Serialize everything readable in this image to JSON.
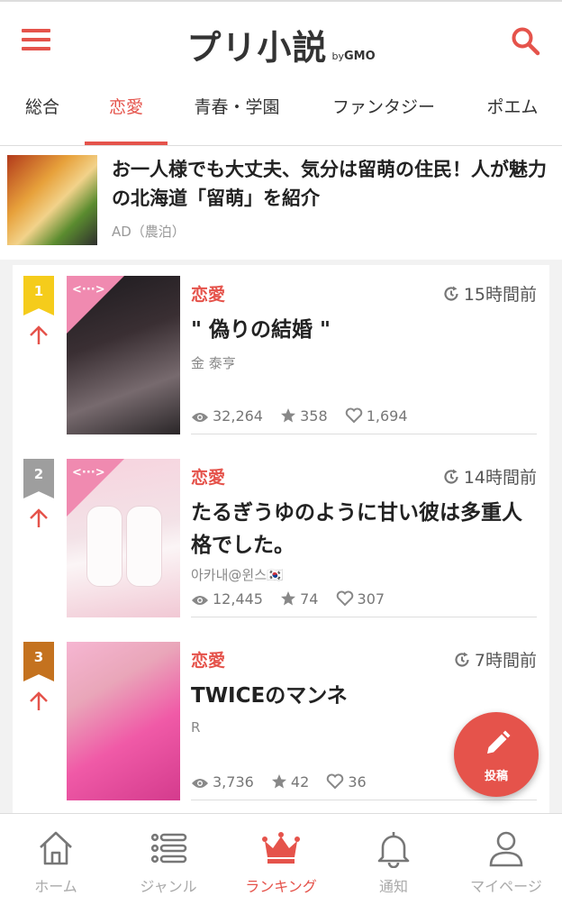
{
  "header": {
    "logo_main": "プリ小説",
    "logo_by": "by",
    "logo_gmo": "GMO"
  },
  "tabs": [
    {
      "label": "総合",
      "active": false
    },
    {
      "label": "恋愛",
      "active": true
    },
    {
      "label": "青春・学園",
      "active": false
    },
    {
      "label": "ファンタジー",
      "active": false
    },
    {
      "label": "ポエム",
      "active": false
    }
  ],
  "ad": {
    "title": "お一人様でも大丈夫、気分は留萌の住民！人が魅力の北海道「留萌」を紹介",
    "label": "AD（農泊）"
  },
  "ranking": [
    {
      "rank": "1",
      "rank_color": "#f5cc1b",
      "genre": "恋愛",
      "time": "15時間前",
      "title": "\" 偽りの結婚 \"",
      "author": "金 泰亨",
      "views": "32,264",
      "stars": "358",
      "likes": "1,694",
      "thumb_code": "<···>"
    },
    {
      "rank": "2",
      "rank_color": "#9e9e9e",
      "genre": "恋愛",
      "time": "14時間前",
      "title": "たるぎうゆのように甘い彼は多重人格でした。",
      "author": "아카내@윈스🇰🇷",
      "views": "12,445",
      "stars": "74",
      "likes": "307",
      "thumb_code": "<···>"
    },
    {
      "rank": "3",
      "rank_color": "#c4721f",
      "genre": "恋愛",
      "time": "7時間前",
      "title": "TWICEのマンネ",
      "author": "R",
      "views": "3,736",
      "stars": "42",
      "likes": "36"
    }
  ],
  "fab": {
    "label": "投稿"
  },
  "bottom_nav": [
    {
      "label": "ホーム",
      "icon": "home-icon",
      "active": false
    },
    {
      "label": "ジャンル",
      "icon": "list-icon",
      "active": false
    },
    {
      "label": "ランキング",
      "icon": "crown-icon",
      "active": true
    },
    {
      "label": "通知",
      "icon": "bell-icon",
      "active": false
    },
    {
      "label": "マイページ",
      "icon": "user-icon",
      "active": false
    }
  ],
  "colors": {
    "accent": "#e5534b",
    "pink": "#f08ab0"
  }
}
